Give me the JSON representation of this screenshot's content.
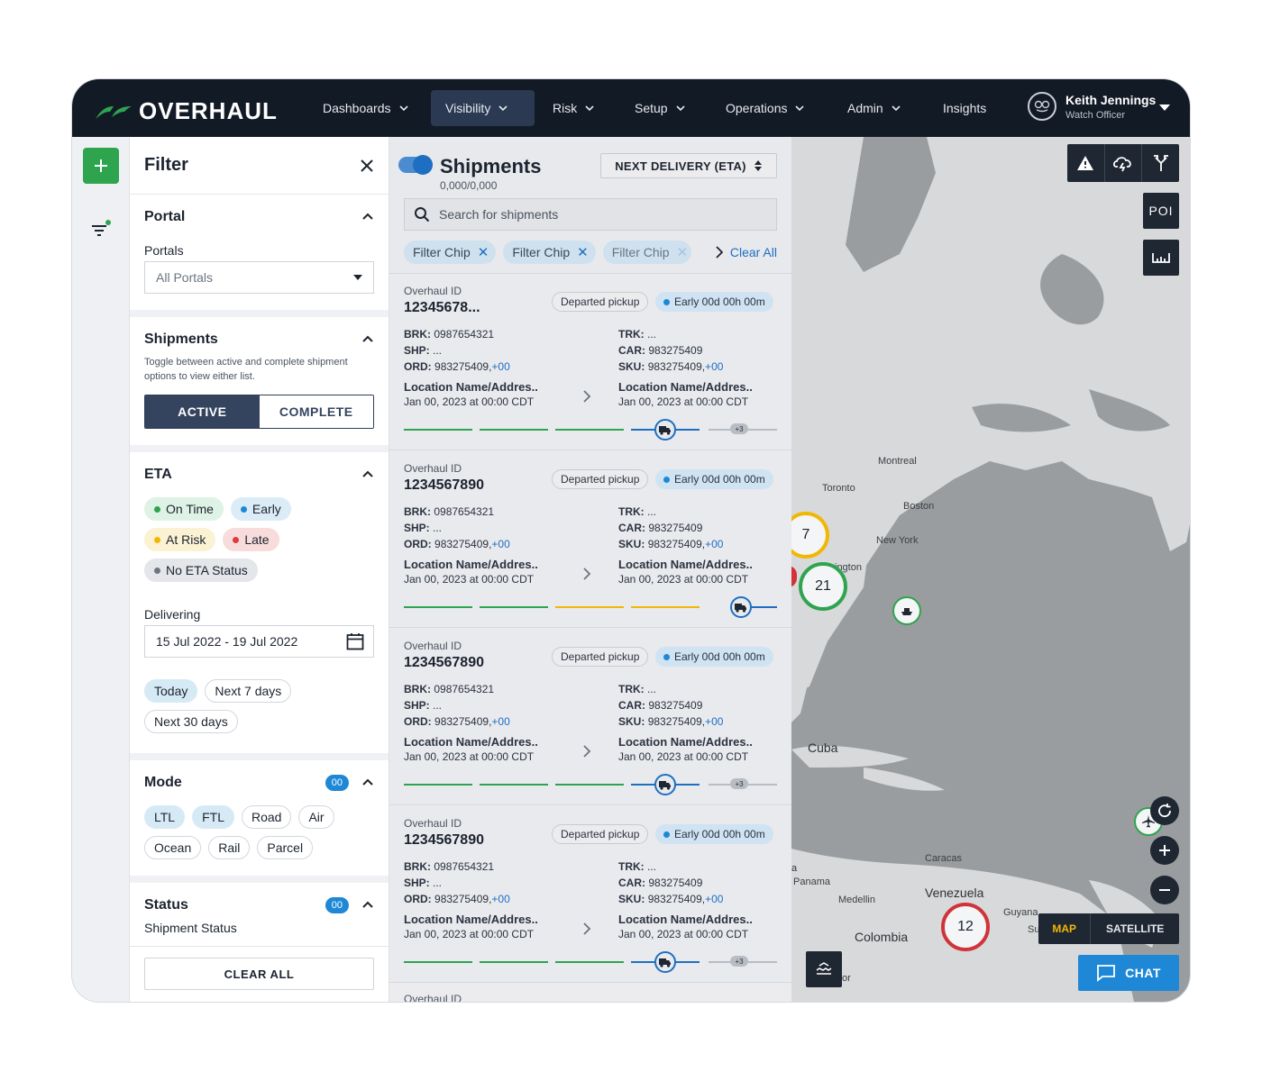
{
  "brand": {
    "name": "OVERHAUL",
    "color": "#2ea44f"
  },
  "nav": {
    "items": [
      "Dashboards",
      "Visibility",
      "Risk",
      "Setup",
      "Operations",
      "Admin",
      "Insights"
    ],
    "active": "Visibility"
  },
  "user": {
    "name": "Keith Jennings",
    "role": "Watch Officer"
  },
  "filter": {
    "title": "Filter",
    "portal": {
      "title": "Portal",
      "label": "Portals",
      "value": "All Portals"
    },
    "shipments": {
      "title": "Shipments",
      "description": "Toggle between active and complete shipment options to view either list.",
      "active_label": "ACTIVE",
      "complete_label": "COMPLETE",
      "selected": "ACTIVE"
    },
    "eta": {
      "title": "ETA",
      "statuses": [
        {
          "label": "On Time",
          "color": "#2ea44f"
        },
        {
          "label": "Early",
          "color": "#1e88d6"
        },
        {
          "label": "At Risk",
          "color": "#f2b705"
        },
        {
          "label": "Late",
          "color": "#e0393e"
        },
        {
          "label": "No ETA Status",
          "color": "#6b7480"
        }
      ],
      "delivering_label": "Delivering",
      "date_range": "15 Jul 2022 - 19 Jul 2022",
      "ranges": [
        "Today",
        "Next 7 days",
        "Next 30 days"
      ],
      "selected_range": "Today"
    },
    "mode": {
      "title": "Mode",
      "badge": "00",
      "options": [
        "LTL",
        "FTL",
        "Road",
        "Air",
        "Ocean",
        "Rail",
        "Parcel"
      ],
      "selected": [
        "LTL",
        "FTL"
      ]
    },
    "status": {
      "title": "Status",
      "badge": "00",
      "label": "Shipment Status"
    },
    "clear_all": "CLEAR ALL"
  },
  "shipments": {
    "title": "Shipments",
    "count": "0,000/0,000",
    "sort_label": "NEXT DELIVERY (ETA)",
    "search_placeholder": "Search for shipments",
    "filter_chips": [
      "Filter Chip",
      "Filter Chip",
      "Filter Chip"
    ],
    "clear_all": "Clear All",
    "cards": [
      {
        "id_label": "Overhaul ID",
        "id": "12345678...",
        "status": "Departed pickup",
        "eta": "Early 00d 00h 00m",
        "brk": "0987654321",
        "shp": "...",
        "ord": "983275409,",
        "ord_more": "+00",
        "trk": "...",
        "car": "983275409",
        "sku": "983275409,",
        "sku_more": "+00",
        "origin_name": "Location Name/Addres..",
        "origin_time": "Jan 00, 2023 at 00:00 CDT",
        "dest_name": "Location Name/Addres..",
        "dest_time": "Jan 00, 2023 at 00:00 CDT",
        "more_stops": "+3"
      },
      {
        "id_label": "Overhaul ID",
        "id": "1234567890",
        "status": "Departed pickup",
        "eta": "Early 00d 00h 00m",
        "brk": "0987654321",
        "shp": "...",
        "ord": "983275409,",
        "ord_more": "+00",
        "trk": "...",
        "car": "983275409",
        "sku": "983275409,",
        "sku_more": "+00",
        "origin_name": "Location Name/Addres..",
        "origin_time": "Jan 00, 2023 at 00:00 CDT",
        "dest_name": "Location Name/Addres..",
        "dest_time": "Jan 00, 2023 at 00:00 CDT",
        "more_stops": ""
      },
      {
        "id_label": "Overhaul ID",
        "id": "1234567890",
        "status": "Departed pickup",
        "eta": "Early 00d 00h 00m",
        "brk": "0987654321",
        "shp": "...",
        "ord": "983275409,",
        "ord_more": "+00",
        "trk": "...",
        "car": "983275409",
        "sku": "983275409,",
        "sku_more": "+00",
        "origin_name": "Location Name/Addres..",
        "origin_time": "Jan 00, 2023 at 00:00 CDT",
        "dest_name": "Location Name/Addres..",
        "dest_time": "Jan 00, 2023 at 00:00 CDT",
        "more_stops": "+3"
      },
      {
        "id_label": "Overhaul ID",
        "id": "1234567890",
        "status": "Departed pickup",
        "eta": "Early 00d 00h 00m",
        "brk": "0987654321",
        "shp": "...",
        "ord": "983275409,",
        "ord_more": "+00",
        "trk": "...",
        "car": "983275409",
        "sku": "983275409,",
        "sku_more": "+00",
        "origin_name": "Location Name/Addres..",
        "origin_time": "Jan 00, 2023 at 00:00 CDT",
        "dest_name": "Location Name/Addres..",
        "dest_time": "Jan 00, 2023 at 00:00 CDT",
        "more_stops": "+3"
      }
    ],
    "next_card_label": "Overhaul ID",
    "field_labels": {
      "brk": "BRK:",
      "shp": "SHP:",
      "ord": "ORD:",
      "trk": "TRK:",
      "car": "CAR:",
      "sku": "SKU:"
    }
  },
  "map": {
    "cities": [
      "Montreal",
      "Toronto",
      "Boston",
      "New York",
      "ington",
      "Caracas",
      "Panama",
      "Medellin",
      "Guyana",
      "Su",
      "or"
    ],
    "countries": [
      "Cuba",
      "Venezuela",
      "Colombia",
      "a"
    ],
    "clusters": [
      {
        "count": "7",
        "color": "#f2b705"
      },
      {
        "count": "21",
        "color": "#2ea44f"
      },
      {
        "count": "12",
        "color": "#d0333a"
      }
    ],
    "poi_label": "POI",
    "map_label": "MAP",
    "satellite_label": "SATELLITE",
    "selected_view": "MAP",
    "chat_label": "CHAT",
    "icons": [
      "warning-icon",
      "cloud-lightning-icon",
      "route-split-icon",
      "ruler-icon",
      "refresh-icon",
      "zoom-in-icon",
      "zoom-out-icon",
      "layers-icon",
      "chat-icon"
    ]
  }
}
